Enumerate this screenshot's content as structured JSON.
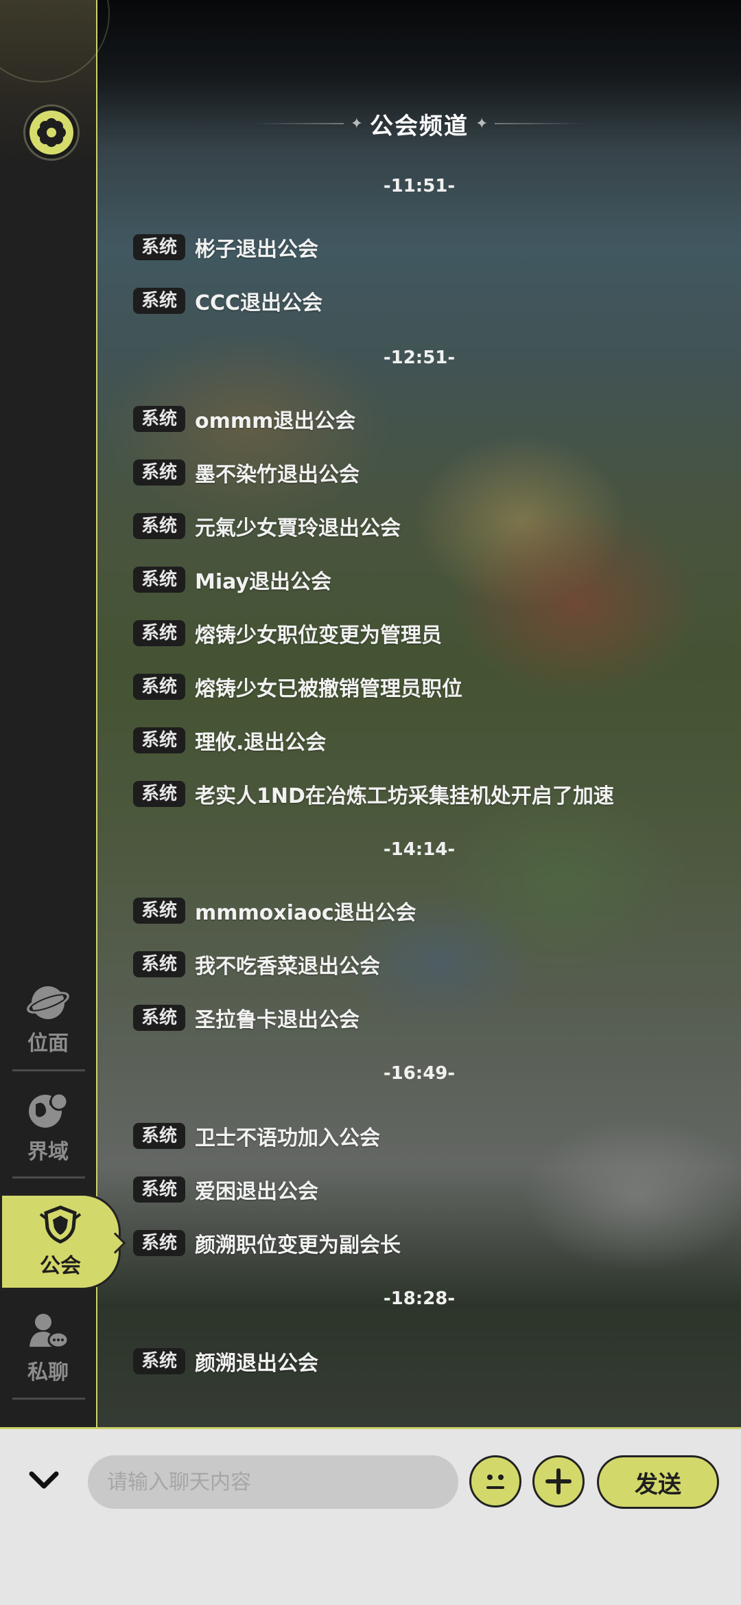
{
  "channel": {
    "title": "公会频道"
  },
  "sidebar": {
    "settings_icon": "gear-icon",
    "items": [
      {
        "label": "位面",
        "icon": "planet-coin-icon",
        "active": false
      },
      {
        "label": "界域",
        "icon": "globe-icon",
        "active": false
      },
      {
        "label": "公会",
        "icon": "guild-shield-icon",
        "active": true
      },
      {
        "label": "私聊",
        "icon": "private-chat-icon",
        "active": false
      }
    ]
  },
  "messages": {
    "groups": [
      {
        "time": "-11:51-",
        "items": [
          {
            "tag": "系统",
            "text": "彬子退出公会"
          },
          {
            "tag": "系统",
            "text": "CCC退出公会"
          }
        ]
      },
      {
        "time": "-12:51-",
        "items": [
          {
            "tag": "系统",
            "text": "ommm退出公会"
          },
          {
            "tag": "系统",
            "text": "墨不染竹退出公会"
          },
          {
            "tag": "系统",
            "text": "元氣少女賈玲退出公会"
          },
          {
            "tag": "系统",
            "text": "Miay退出公会"
          },
          {
            "tag": "系统",
            "text": "熔铸少女职位变更为管理员"
          },
          {
            "tag": "系统",
            "text": "熔铸少女已被撤销管理员职位"
          },
          {
            "tag": "系统",
            "text": "理攸.退出公会"
          },
          {
            "tag": "系统",
            "text": "老实人1ND在冶炼工坊采集挂机处开启了加速"
          }
        ]
      },
      {
        "time": "-14:14-",
        "items": [
          {
            "tag": "系统",
            "text": "mmmoxiaoc退出公会"
          },
          {
            "tag": "系统",
            "text": "我不吃香菜退出公会"
          },
          {
            "tag": "系统",
            "text": "圣拉鲁卡退出公会"
          }
        ]
      },
      {
        "time": "-16:49-",
        "items": [
          {
            "tag": "系统",
            "text": "卫士不语功加入公会"
          },
          {
            "tag": "系统",
            "text": "爱困退出公会"
          },
          {
            "tag": "系统",
            "text": "颜溯职位变更为副会长"
          }
        ]
      },
      {
        "time": "-18:28-",
        "items": [
          {
            "tag": "系统",
            "text": "颜溯退出公会"
          }
        ]
      }
    ]
  },
  "input": {
    "placeholder": "请输入聊天内容",
    "value": "",
    "send_label": "发送"
  },
  "colors": {
    "accent": "#d3d86b",
    "sidebar_bg": "#202020",
    "input_bar_bg": "#e5e5e5"
  }
}
